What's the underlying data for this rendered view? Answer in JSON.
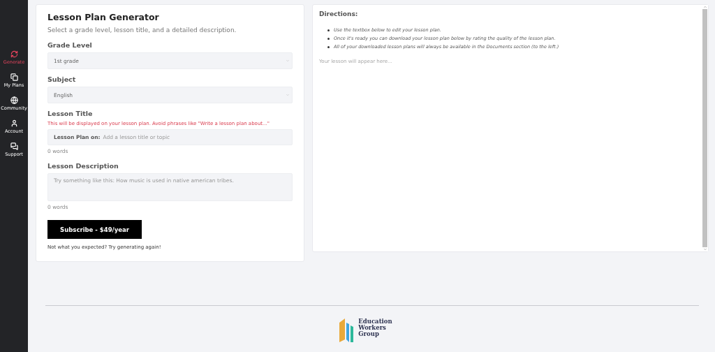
{
  "sidebar": {
    "items": [
      {
        "label": "Generate",
        "selected": true
      },
      {
        "label": "My Plans",
        "selected": false
      },
      {
        "label": "Community",
        "selected": false
      },
      {
        "label": "Account",
        "selected": false
      },
      {
        "label": "Support",
        "selected": false
      }
    ]
  },
  "generator": {
    "title": "Lesson Plan Generator",
    "subtitle": "Select a grade level, lesson title, and a detailed description.",
    "grade_level": {
      "label": "Grade Level",
      "value": "1st grade"
    },
    "subject": {
      "label": "Subject",
      "value": "English"
    },
    "lesson_title": {
      "label": "Lesson Title",
      "hint": "This will be displayed on your lesson plan. Avoid phrases like \"Write a lesson plan about...\"",
      "prefix": "Lesson Plan on:",
      "placeholder": "Add a lesson title or topic",
      "word_count": "0 words"
    },
    "lesson_description": {
      "label": "Lesson Description",
      "placeholder": "Try something like this: How music is used in native american tribes.",
      "word_count": "0 words"
    },
    "subscribe_button": "Subscribe - $49/year",
    "note": "Not what you expected? Try generating again!"
  },
  "output": {
    "heading": "Directions:",
    "directions": [
      "Use the textbox below to edit your lesson plan.",
      "Once it's ready you can download your lesson plan below by rating the quality of the lesson plan.",
      "All of your downloaded lesson plans will always be available in the Documents section (to the left.)"
    ],
    "placeholder": "Your lesson will appear here..."
  },
  "footer": {
    "logo_lines": [
      "Education",
      "Workers",
      "Group"
    ]
  }
}
